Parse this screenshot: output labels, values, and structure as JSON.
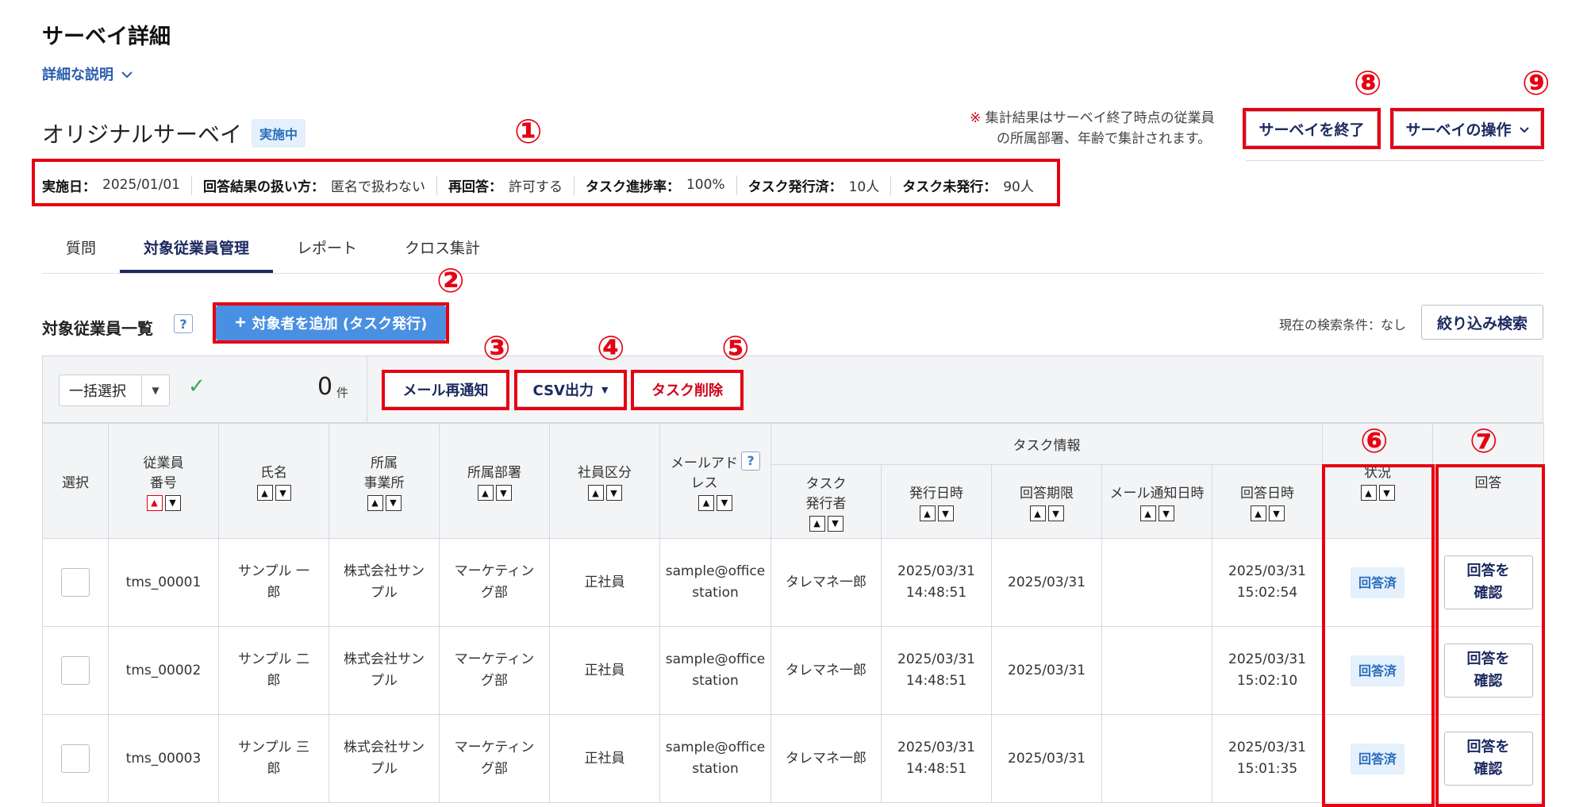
{
  "header": {
    "title": "サーベイ詳細",
    "detail_link": "詳細な説明",
    "survey_name": "オリジナルサーベイ",
    "status": "実施中",
    "note_mark": "※",
    "note_line1": "集計結果はサーベイ終了時点の従業員",
    "note_line2": "の所属部署、年齢で集計されます。",
    "end_button": "サーベイを終了",
    "ops_button": "サーベイの操作"
  },
  "info": [
    {
      "label": "実施日：",
      "value": "2025/01/01"
    },
    {
      "label": "回答結果の扱い方：",
      "value": "匿名で扱わない"
    },
    {
      "label": "再回答：",
      "value": "許可する"
    },
    {
      "label": "タスク進捗率：",
      "value": "100%"
    },
    {
      "label": "タスク発行済：",
      "value": "10人"
    },
    {
      "label": "タスク未発行：",
      "value": "90人"
    }
  ],
  "tabs": [
    "質問",
    "対象従業員管理",
    "レポート",
    "クロス集計"
  ],
  "section": {
    "title": "対象従業員一覧",
    "help": "?",
    "add_button": "対象者を追加 (タスク発行)",
    "search_condition": "現在の検索条件：なし",
    "filter_button": "絞り込み検索"
  },
  "toolbar": {
    "bulk_select": "一括選択",
    "count": "0",
    "count_unit": "件",
    "mail_button": "メール再通知",
    "csv_button": "CSV出力",
    "delete_button": "タスク削除"
  },
  "annotations": [
    "①",
    "②",
    "③",
    "④",
    "⑤",
    "⑥",
    "⑦",
    "⑧",
    "⑨"
  ],
  "table": {
    "headers": {
      "select": "選択",
      "emp_no_1": "従業員",
      "emp_no_2": "番号",
      "name": "氏名",
      "office_1": "所属",
      "office_2": "事業所",
      "dept": "所属部署",
      "type": "社員区分",
      "mail_1": "メールアド",
      "mail_2": "レス",
      "task_info": "タスク情報",
      "issuer_1": "タスク",
      "issuer_2": "発行者",
      "issued": "発行日時",
      "deadline": "回答期限",
      "mail_notify": "メール通知日時",
      "answered_at": "回答日時",
      "status": "状況",
      "answer": "回答"
    },
    "rows": [
      {
        "emp_no": "tms_00001",
        "name_1": "サンプル 一",
        "name_2": "郎",
        "office_1": "株式会社サン",
        "office_2": "プル",
        "dept_1": "マーケティン",
        "dept_2": "グ部",
        "type": "正社員",
        "mail_1": "sample@office",
        "mail_2": "station",
        "issuer": "タレマネ一郎",
        "issued_1": "2025/03/31",
        "issued_2": "14:48:51",
        "deadline": "2025/03/31",
        "notify": "",
        "ans_1": "2025/03/31",
        "ans_2": "15:02:54",
        "status": "回答済",
        "btn_1": "回答を",
        "btn_2": "確認"
      },
      {
        "emp_no": "tms_00002",
        "name_1": "サンプル 二",
        "name_2": "郎",
        "office_1": "株式会社サン",
        "office_2": "プル",
        "dept_1": "マーケティン",
        "dept_2": "グ部",
        "type": "正社員",
        "mail_1": "sample@office",
        "mail_2": "station",
        "issuer": "タレマネ一郎",
        "issued_1": "2025/03/31",
        "issued_2": "14:48:51",
        "deadline": "2025/03/31",
        "notify": "",
        "ans_1": "2025/03/31",
        "ans_2": "15:02:10",
        "status": "回答済",
        "btn_1": "回答を",
        "btn_2": "確認"
      },
      {
        "emp_no": "tms_00003",
        "name_1": "サンプル 三",
        "name_2": "郎",
        "office_1": "株式会社サン",
        "office_2": "プル",
        "dept_1": "マーケティン",
        "dept_2": "グ部",
        "type": "正社員",
        "mail_1": "sample@office",
        "mail_2": "station",
        "issuer": "タレマネ一郎",
        "issued_1": "2025/03/31",
        "issued_2": "14:48:51",
        "deadline": "2025/03/31",
        "notify": "",
        "ans_1": "2025/03/31",
        "ans_2": "15:01:35",
        "status": "回答済",
        "btn_1": "回答を",
        "btn_2": "確認"
      }
    ]
  },
  "colors": {
    "accent": "#1c2a60",
    "primary_button": "#4a90e2",
    "annotation_red": "#e60012",
    "badge_bg": "#e4f0fb",
    "badge_text": "#2a6ebd"
  }
}
